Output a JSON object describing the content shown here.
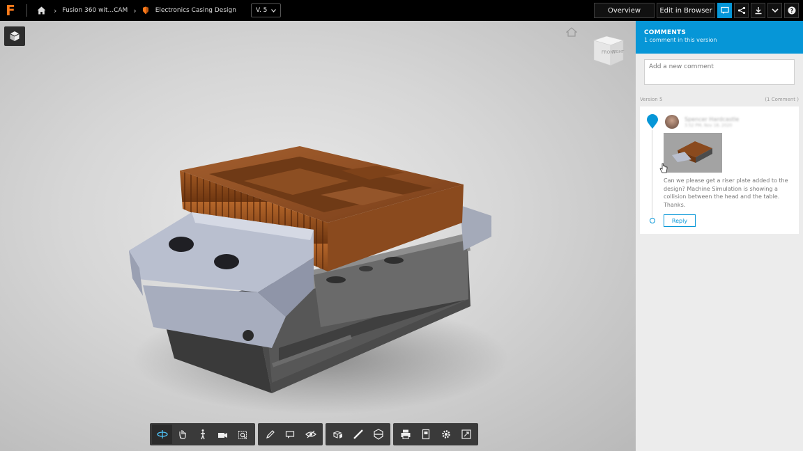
{
  "breadcrumb": {
    "project": "Fusion 360 wit...CAM",
    "design": "Electronics Casing Design",
    "version": "V. 5"
  },
  "topbar": {
    "overview_label": "Overview",
    "edit_label": "Edit in Browser",
    "logo_text": "F",
    "logo_color": "#ff7a1a",
    "accent": "#0696d7"
  },
  "viewcube": {
    "front": "FRONT",
    "right": "RIGHT"
  },
  "comments": {
    "title": "COMMENTS",
    "subtitle": "1 comment in this version",
    "placeholder": "Add a new comment",
    "version_label": "Version 5",
    "count_label": "(1 Comment )",
    "items": [
      {
        "author": "Spencer Hardcastle",
        "date": "3:52 PM, Nov 18, 2020",
        "text": "Can we please get a riser plate added to the design? Machine Simulation is showing a collision between the head and the table. Thanks.",
        "reply_label": "Reply"
      }
    ]
  },
  "toolbar": {
    "groups": [
      [
        "orbit-icon",
        "pan-icon",
        "walk-icon",
        "camera-icon",
        "fit-icon"
      ],
      [
        "markup-icon",
        "comment-icon",
        "visibility-icon"
      ],
      [
        "explode-icon",
        "measure-icon",
        "section-icon"
      ],
      [
        "print-icon",
        "properties-icon",
        "settings-icon",
        "fullscreen-icon"
      ]
    ]
  }
}
